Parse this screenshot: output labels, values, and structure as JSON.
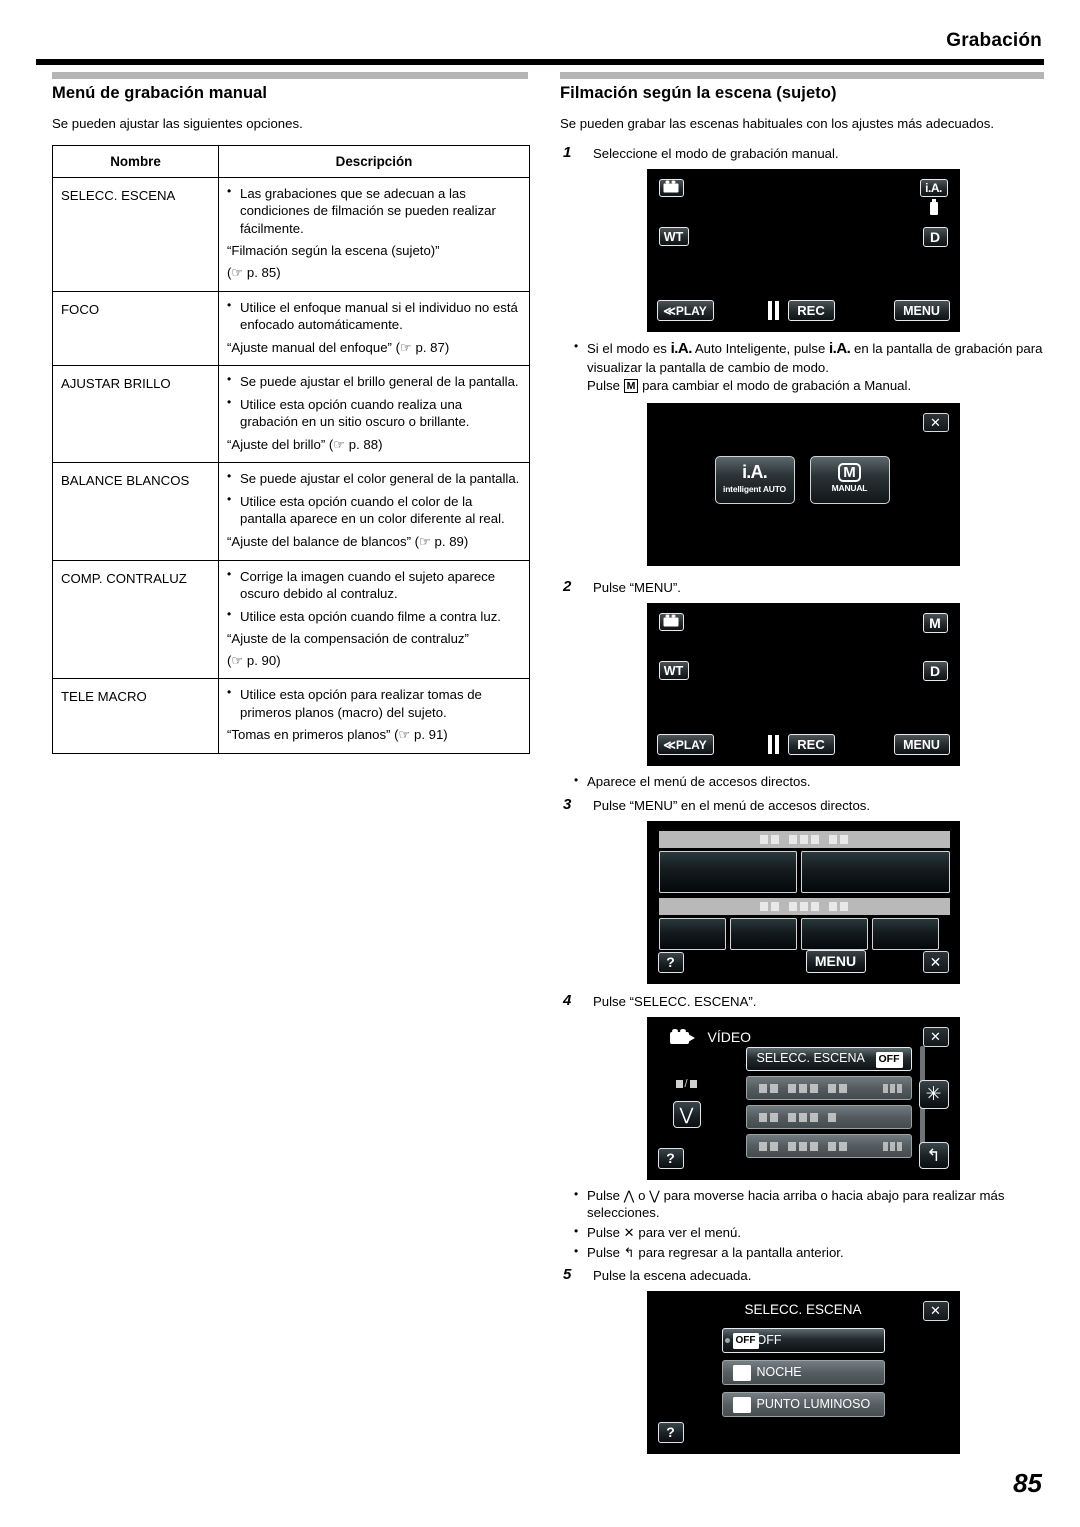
{
  "header": {
    "title": "Grabación",
    "page_number": "85"
  },
  "left": {
    "section_title": "Menú de grabación manual",
    "intro": "Se pueden ajustar las siguientes opciones.",
    "table": {
      "headers": [
        "Nombre",
        "Descripción"
      ],
      "rows": [
        {
          "name": "SELECC. ESCENA",
          "bullets": [
            "Las grabaciones que se adecuan a las condiciones de filmación se pueden realizar fácilmente."
          ],
          "ref": "“Filmación según la escena (sujeto)”",
          "ref_page": "(☞ p. 85)"
        },
        {
          "name": "FOCO",
          "bullets": [
            "Utilice el enfoque manual si el individuo no está enfocado automáticamente."
          ],
          "ref": "“Ajuste manual del enfoque” (☞ p. 87)",
          "ref_page": ""
        },
        {
          "name": "AJUSTAR BRILLO",
          "bullets": [
            "Se puede ajustar el brillo general de la pantalla.",
            "Utilice esta opción cuando realiza una grabación en un sitio oscuro o brillante."
          ],
          "ref": "“Ajuste del brillo” (☞ p. 88)",
          "ref_page": ""
        },
        {
          "name": "BALANCE BLANCOS",
          "bullets": [
            "Se puede ajustar el color general de la pantalla.",
            "Utilice esta opción cuando el color de la pantalla aparece en un color diferente al real."
          ],
          "ref": "“Ajuste del balance de blancos” (☞ p. 89)",
          "ref_page": ""
        },
        {
          "name": "COMP. CONTRALUZ",
          "bullets": [
            "Corrige la imagen cuando el sujeto aparece oscuro debido al contraluz.",
            "Utilice esta opción cuando filme a contra luz."
          ],
          "ref": "“Ajuste de la compensación de contraluz”",
          "ref_page": "(☞ p. 90)"
        },
        {
          "name": "TELE MACRO",
          "bullets": [
            "Utilice esta opción para realizar tomas de primeros planos (macro) del sujeto."
          ],
          "ref": "“Tomas en primeros planos” (☞ p. 91)",
          "ref_page": ""
        }
      ]
    }
  },
  "right": {
    "section_title": "Filmación según la escena (sujeto)",
    "intro": "Se pueden grabar las escenas habituales con los ajustes más adecuados.",
    "steps": [
      {
        "num": "1",
        "text": "Seleccione el modo de grabación manual."
      },
      {
        "num": "2",
        "text": "Pulse “MENU”."
      },
      {
        "num": "3",
        "text": "Pulse “MENU” en el menú de accesos directos."
      },
      {
        "num": "4",
        "text": "Pulse “SELECC. ESCENA”."
      },
      {
        "num": "5",
        "text": "Pulse la escena adecuada."
      }
    ],
    "note_after_step1_parts": {
      "a": "Si el modo es ",
      "ia1": "i.A.",
      "b": " Auto Inteligente, pulse ",
      "ia2": "i.A.",
      "c": " en la pantalla de grabación para visualizar la pantalla de cambio de modo.",
      "d": "Pulse ",
      "m": "M",
      "e": " para cambiar el modo de grabación a Manual."
    },
    "note_after_step2": "Aparece el menú de accesos directos.",
    "notes_after_step4": [
      "Pulse ⋀ o ⋁ para moverse hacia arriba o hacia abajo para realizar más selecciones.",
      "Pulse ✕ para ver el menú.",
      "Pulse ↰ para regresar a la pantalla anterior."
    ]
  },
  "screens": {
    "rec_ia": {
      "icons": {
        "camcorder": "camcorder-icon",
        "mode": "i.A.",
        "zoom": "WT",
        "display": "D",
        "battery": "battery-icon"
      },
      "buttons": {
        "play": "≪PLAY",
        "rec": "REC",
        "menu": "MENU"
      }
    },
    "mode_select": {
      "close": "✕",
      "auto": {
        "big": "i.A.",
        "small": "intelligent AUTO"
      },
      "manual": {
        "big": "M",
        "small": "MANUAL"
      }
    },
    "rec_manual": {
      "icons": {
        "camcorder": "camcorder-icon",
        "mode": "M",
        "zoom": "WT",
        "display": "D"
      },
      "buttons": {
        "play": "≪PLAY",
        "rec": "REC",
        "menu": "MENU"
      }
    },
    "shortcut_menu": {
      "menu_button": "MENU",
      "help_button": "?",
      "close_button": "✕"
    },
    "video_menu": {
      "title": "VÍDEO",
      "close": "✕",
      "gear": "gear-icon",
      "back": "back-arrow-icon",
      "down": "⋁",
      "help": "?",
      "selected_row": {
        "label": "SELECC. ESCENA",
        "value": "OFF"
      }
    },
    "scene_select": {
      "title": "SELECC. ESCENA",
      "close": "✕",
      "help": "?",
      "options": [
        {
          "icon": "off-icon",
          "label": "OFF",
          "selected": true
        },
        {
          "icon": "night-icon",
          "label": "NOCHE",
          "selected": false
        },
        {
          "icon": "spotlight-icon",
          "label": "PUNTO LUMINOSO",
          "selected": false
        }
      ]
    }
  }
}
